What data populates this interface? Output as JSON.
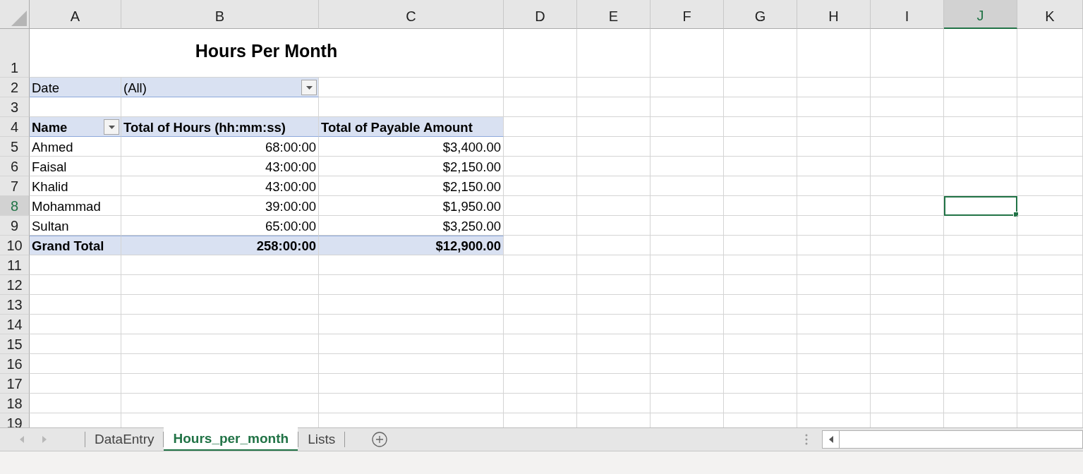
{
  "columns": [
    {
      "label": "A",
      "selected": false
    },
    {
      "label": "B",
      "selected": false
    },
    {
      "label": "C",
      "selected": false
    },
    {
      "label": "D",
      "selected": false
    },
    {
      "label": "E",
      "selected": false
    },
    {
      "label": "F",
      "selected": false
    },
    {
      "label": "G",
      "selected": false
    },
    {
      "label": "H",
      "selected": false
    },
    {
      "label": "I",
      "selected": false
    },
    {
      "label": "J",
      "selected": true
    },
    {
      "label": "K",
      "selected": false
    }
  ],
  "rows": [
    {
      "label": "1",
      "selected": false
    },
    {
      "label": "2",
      "selected": false
    },
    {
      "label": "3",
      "selected": false
    },
    {
      "label": "4",
      "selected": false
    },
    {
      "label": "5",
      "selected": false
    },
    {
      "label": "6",
      "selected": false
    },
    {
      "label": "7",
      "selected": false
    },
    {
      "label": "8",
      "selected": true
    },
    {
      "label": "9",
      "selected": false
    },
    {
      "label": "10",
      "selected": false
    },
    {
      "label": "11",
      "selected": false
    },
    {
      "label": "12",
      "selected": false
    },
    {
      "label": "13",
      "selected": false
    },
    {
      "label": "14",
      "selected": false
    },
    {
      "label": "15",
      "selected": false
    },
    {
      "label": "16",
      "selected": false
    },
    {
      "label": "17",
      "selected": false
    },
    {
      "label": "18",
      "selected": false
    },
    {
      "label": "19",
      "selected": false
    }
  ],
  "pivot": {
    "title": "Hours Per Month",
    "filter": {
      "label": "Date",
      "value": "(All)"
    },
    "headers": [
      "Name",
      "Total of Hours (hh:mm:ss)",
      "Total of Payable Amount"
    ],
    "data": [
      [
        "Ahmed",
        "68:00:00",
        "$3,400.00"
      ],
      [
        "Faisal",
        "43:00:00",
        "$2,150.00"
      ],
      [
        "Khalid",
        "43:00:00",
        "$2,150.00"
      ],
      [
        "Mohammad",
        "39:00:00",
        "$1,950.00"
      ],
      [
        "Sultan",
        "65:00:00",
        "$3,250.00"
      ]
    ],
    "grand_total": [
      "Grand Total",
      "258:00:00",
      "$12,900.00"
    ]
  },
  "sheet_tabs": [
    {
      "label": "DataEntry",
      "selected": false
    },
    {
      "label": "Hours_per_month",
      "selected": true
    },
    {
      "label": "Lists",
      "selected": false
    }
  ]
}
